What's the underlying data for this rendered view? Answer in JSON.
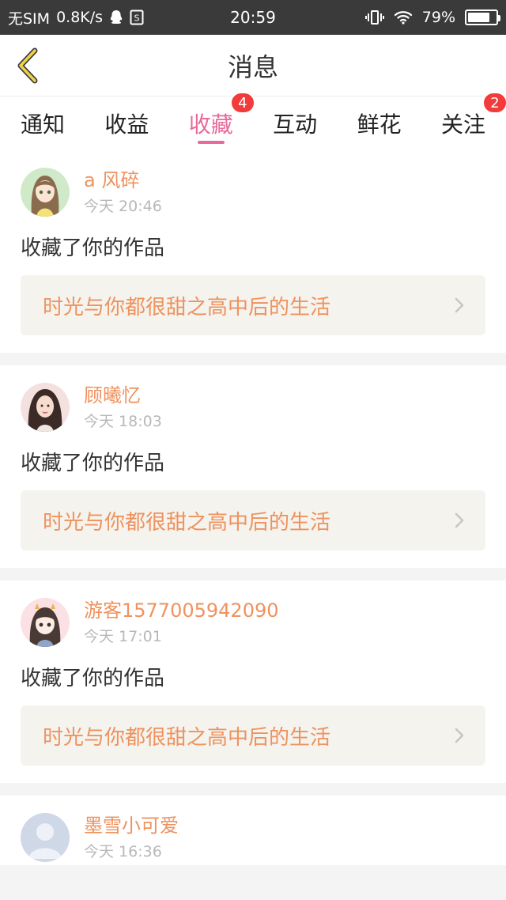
{
  "status_bar": {
    "carrier": "无SIM",
    "speed": "0.8K/s",
    "time": "20:59",
    "battery": "79%",
    "battery_level": 0.79,
    "icons": [
      "qq-icon",
      "sim-icon",
      "vibrate-icon",
      "wifi-icon",
      "battery-icon"
    ]
  },
  "header": {
    "title": "消息",
    "back_icon": "chevron-left-icon"
  },
  "tabs": [
    {
      "label": "通知",
      "badge": ""
    },
    {
      "label": "收益",
      "badge": ""
    },
    {
      "label": "收藏",
      "badge": "4",
      "active": true
    },
    {
      "label": "互动",
      "badge": ""
    },
    {
      "label": "鲜花",
      "badge": ""
    },
    {
      "label": "关注",
      "badge": "2"
    }
  ],
  "colors": {
    "accent_pink": "#e76a9a",
    "name_orange": "#ef925e",
    "badge_red": "#f23b3b"
  },
  "messages": [
    {
      "name": "a 风碎",
      "time": "今天 20:46",
      "action": "收藏了你的作品",
      "work_title": "时光与你都很甜之高中后的生活",
      "avatar": "avatar-girl-anime-icon"
    },
    {
      "name": "顾曦忆",
      "time": "今天 18:03",
      "action": "收藏了你的作品",
      "work_title": "时光与你都很甜之高中后的生活",
      "avatar": "avatar-photo-icon"
    },
    {
      "name": "游客1577005942090",
      "time": "今天 17:01",
      "action": "收藏了你的作品",
      "work_title": "时光与你都很甜之高中后的生活",
      "avatar": "avatar-cartoon-icon"
    },
    {
      "name": "墨雪小可爱",
      "time": "今天 16:36",
      "action": "",
      "work_title": "",
      "avatar": "avatar-default-icon"
    }
  ]
}
